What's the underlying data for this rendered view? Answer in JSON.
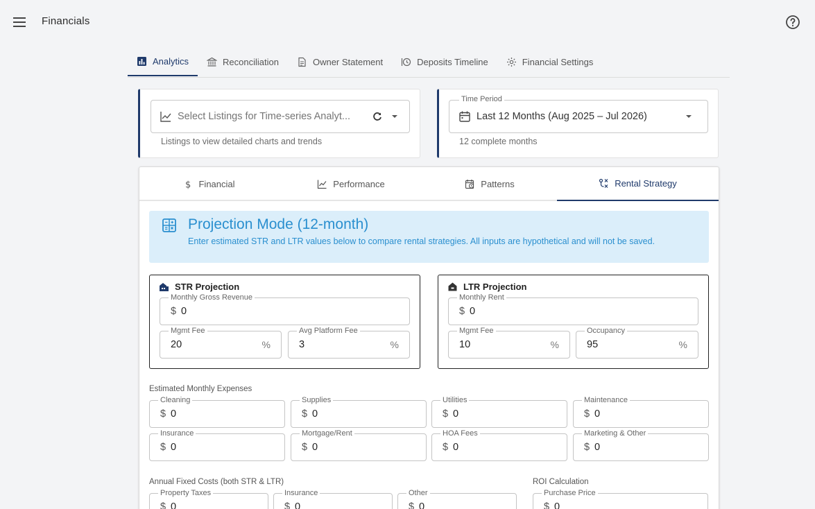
{
  "app": {
    "title": "Financials"
  },
  "main_tabs": [
    {
      "label": "Analytics",
      "icon": "bar-chart-icon",
      "active": true
    },
    {
      "label": "Reconciliation",
      "icon": "bank-icon",
      "active": false
    },
    {
      "label": "Owner Statement",
      "icon": "document-icon",
      "active": false
    },
    {
      "label": "Deposits Timeline",
      "icon": "timeline-icon",
      "active": false
    },
    {
      "label": "Financial Settings",
      "icon": "gear-icon",
      "active": false
    }
  ],
  "listings_filter": {
    "placeholder": "Select Listings for Time-series Analyt...",
    "helper": "Listings to view detailed charts and trends"
  },
  "time_period": {
    "label": "Time Period",
    "value": "Last 12 Months (Aug 2025 – Jul 2026)",
    "helper": "12 complete months"
  },
  "sub_tabs": [
    {
      "label": "Financial",
      "icon": "dollar-icon",
      "active": false
    },
    {
      "label": "Performance",
      "icon": "line-chart-icon",
      "active": false
    },
    {
      "label": "Patterns",
      "icon": "calendar-clock-icon",
      "active": false
    },
    {
      "label": "Rental Strategy",
      "icon": "strategy-icon",
      "active": true
    }
  ],
  "banner": {
    "title": "Projection Mode (12-month)",
    "description": "Enter estimated STR and LTR values below to compare rental strategies. All inputs are hypothetical and will not be saved."
  },
  "str_projection": {
    "title": "STR Projection",
    "monthly_gross_revenue": {
      "label": "Monthly Gross Revenue",
      "prefix": "$",
      "value": "0"
    },
    "mgmt_fee": {
      "label": "Mgmt Fee",
      "value": "20",
      "suffix": "%"
    },
    "avg_platform_fee": {
      "label": "Avg Platform Fee",
      "value": "3",
      "suffix": "%"
    }
  },
  "ltr_projection": {
    "title": "LTR Projection",
    "monthly_rent": {
      "label": "Monthly Rent",
      "prefix": "$",
      "value": "0"
    },
    "mgmt_fee": {
      "label": "Mgmt Fee",
      "value": "10",
      "suffix": "%"
    },
    "occupancy": {
      "label": "Occupancy",
      "value": "95",
      "suffix": "%"
    }
  },
  "monthly_expenses": {
    "label": "Estimated Monthly Expenses",
    "fields": [
      {
        "label": "Cleaning",
        "prefix": "$",
        "value": "0"
      },
      {
        "label": "Supplies",
        "prefix": "$",
        "value": "0"
      },
      {
        "label": "Utilities",
        "prefix": "$",
        "value": "0"
      },
      {
        "label": "Maintenance",
        "prefix": "$",
        "value": "0"
      },
      {
        "label": "Insurance",
        "prefix": "$",
        "value": "0"
      },
      {
        "label": "Mortgage/Rent",
        "prefix": "$",
        "value": "0"
      },
      {
        "label": "HOA Fees",
        "prefix": "$",
        "value": "0"
      },
      {
        "label": "Marketing & Other",
        "prefix": "$",
        "value": "0"
      }
    ]
  },
  "annual_fixed": {
    "label": "Annual Fixed Costs (both STR & LTR)",
    "fields": [
      {
        "label": "Property Taxes",
        "prefix": "$",
        "value": "0"
      },
      {
        "label": "Insurance",
        "prefix": "$",
        "value": "0"
      },
      {
        "label": "Other",
        "prefix": "$",
        "value": "0"
      }
    ]
  },
  "roi": {
    "label": "ROI Calculation",
    "purchase_price": {
      "label": "Purchase Price",
      "prefix": "$",
      "value": "0"
    }
  },
  "colors": {
    "primary": "#1f3a6b",
    "info_bg": "#dbeefa",
    "info_text": "#2a8fcf",
    "background": "#f3f4f6"
  }
}
